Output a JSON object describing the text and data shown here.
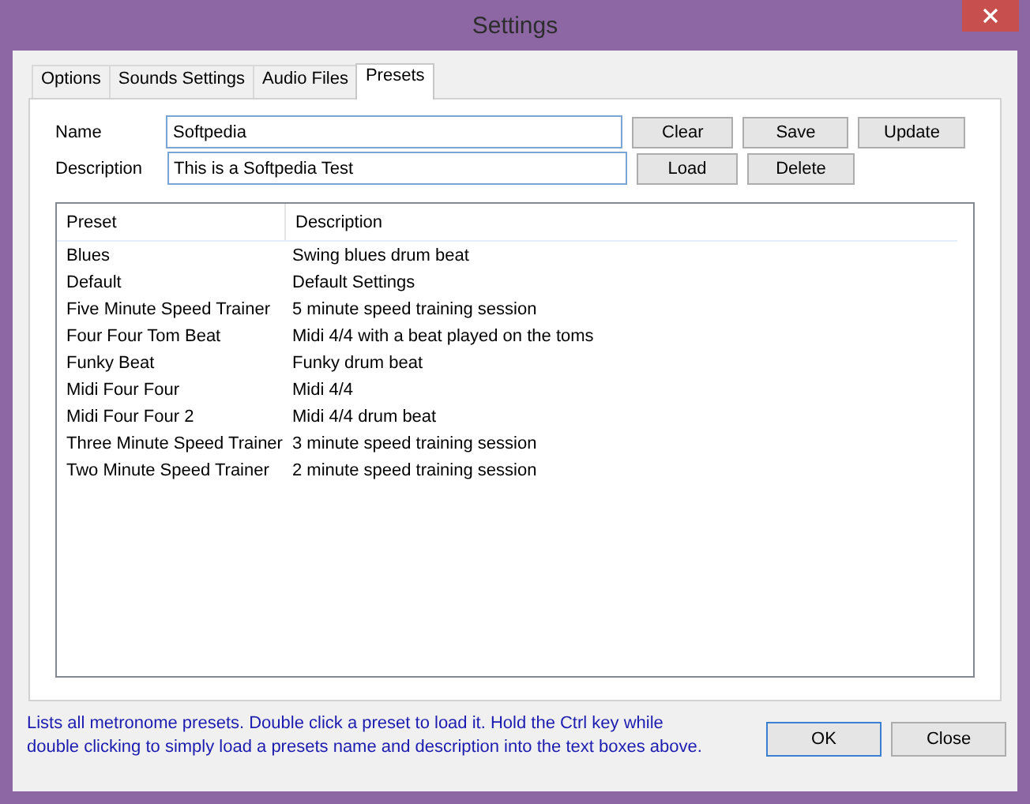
{
  "window": {
    "title": "Settings"
  },
  "tabs": [
    {
      "label": "Options",
      "selected": false
    },
    {
      "label": "Sounds Settings",
      "selected": false
    },
    {
      "label": "Audio Files",
      "selected": false
    },
    {
      "label": "Presets",
      "selected": true
    }
  ],
  "form": {
    "fields": [
      {
        "label": "Name",
        "value": "Softpedia"
      },
      {
        "label": "Description",
        "value": "This is a Softpedia Test"
      }
    ],
    "buttons": [
      [
        "Clear",
        "Save",
        "Update"
      ],
      [
        "Load",
        "Delete"
      ]
    ]
  },
  "table": {
    "columns": [
      "Preset",
      "Description"
    ],
    "rows": [
      [
        "Blues",
        "Swing blues drum beat"
      ],
      [
        "Default",
        "Default Settings"
      ],
      [
        "Five Minute Speed Trainer",
        "5 minute speed training session"
      ],
      [
        "Four Four Tom Beat",
        "Midi 4/4 with a beat played on the toms"
      ],
      [
        "Funky Beat",
        "Funky drum beat"
      ],
      [
        "Midi Four Four",
        "Midi 4/4"
      ],
      [
        "Midi Four Four 2",
        "Midi 4/4 drum beat"
      ],
      [
        "Three Minute Speed Trainer",
        "3 minute speed training session"
      ],
      [
        "Two Minute Speed Trainer",
        "2 minute speed training session"
      ]
    ]
  },
  "help_text": "Lists all metronome presets. Double click a preset to load it. Hold the Ctrl key while double clicking to simply load a presets name and description into the text boxes above.",
  "buttons": [
    {
      "label": "OK",
      "default": true
    },
    {
      "label": "Close",
      "default": false
    }
  ]
}
